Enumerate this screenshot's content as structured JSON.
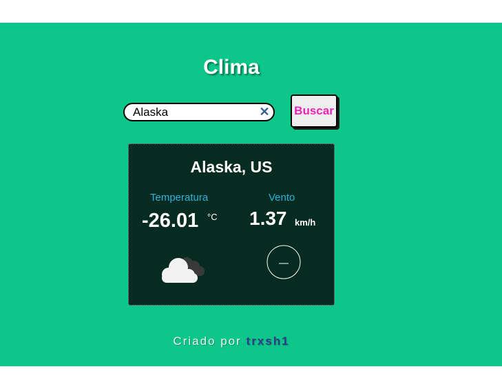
{
  "app": {
    "title": "Clima"
  },
  "search": {
    "value": "Alaska",
    "button_label": "Buscar"
  },
  "weather": {
    "location": "Alaska, US",
    "temperature_label": "Temperatura",
    "temperature_value": "-26.01",
    "temperature_unit": "°C",
    "wind_label": "Vento",
    "wind_value": "1.37",
    "wind_unit": "km/h",
    "condition_icon": "cloud-icon",
    "wind_direction_icon": "compass-icon"
  },
  "footer": {
    "prefix": "Criado por",
    "author": "trxsh1"
  },
  "colors": {
    "page_background": "#0dc68a",
    "card_background": "#062b20",
    "label_accent": "#2db3e0",
    "button_text": "#ee22bb",
    "author_link": "#333a8c"
  }
}
